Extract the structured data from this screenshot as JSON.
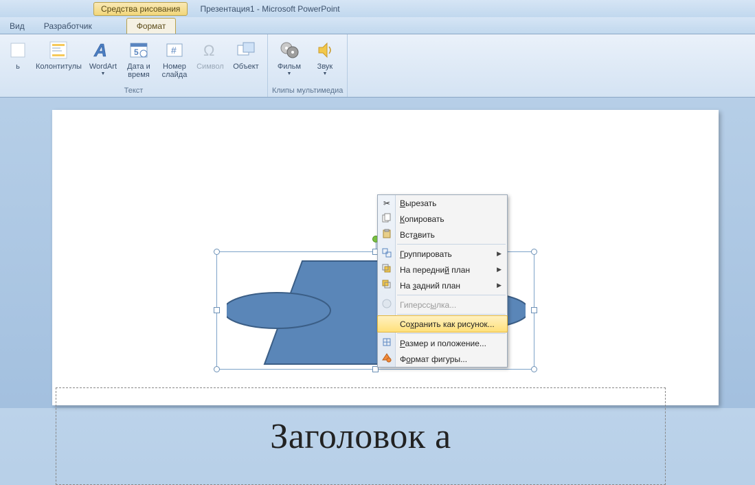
{
  "titlebar": {
    "drawing_tools": "Средства рисования",
    "doc_title": "Презентация1 - Microsoft PowerPoint"
  },
  "tabs": {
    "view": "Вид",
    "developer": "Разработчик",
    "format": "Формат"
  },
  "ribbon": {
    "text_group": {
      "label": "Текст",
      "colontitles": "Колонтитулы",
      "wordart": "WordArt",
      "datetime": "Дата и\nвремя",
      "slidenum": "Номер\nслайда",
      "symbol": "Символ",
      "object": "Объект"
    },
    "media_group": {
      "label": "Клипы мультимедиа",
      "movie": "Фильм",
      "sound": "Звук"
    }
  },
  "slide": {
    "title_placeholder_visible": "Заголовок               а"
  },
  "context_menu": {
    "cut": "Вырезать",
    "copy": "Копировать",
    "paste": "Вставить",
    "group": "Группировать",
    "bring_front": "На передний план",
    "send_back": "На задний план",
    "hyperlink": "Гиперссылка...",
    "save_as_pic": "Сохранить как рисунок...",
    "size_pos": "Размер и положение...",
    "format_shape": "Формат фигуры..."
  }
}
